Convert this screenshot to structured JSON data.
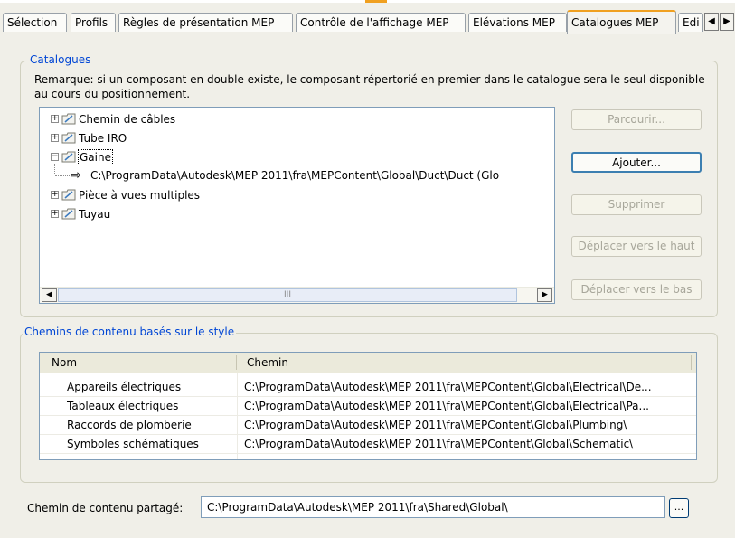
{
  "tabs": [
    {
      "label": "Sélection"
    },
    {
      "label": "Profils"
    },
    {
      "label": "Règles de présentation MEP"
    },
    {
      "label": "Contrôle de l'affichage MEP"
    },
    {
      "label": "Elévations MEP"
    },
    {
      "label": "Catalogues MEP"
    },
    {
      "label": "Edi"
    }
  ],
  "active_tab": "Catalogues MEP",
  "catalogues": {
    "legend": "Catalogues",
    "note": "Remarque: si un composant en double existe, le composant répertorié en premier dans le catalogue sera le seul disponible au cours du positionnement.",
    "tree": [
      {
        "label": "Chemin de câbles",
        "expanded": false
      },
      {
        "label": "Tube IRO",
        "expanded": false
      },
      {
        "label": "Gaine",
        "expanded": true,
        "selected": true
      },
      {
        "label": "C:\\ProgramData\\Autodesk\\MEP 2011\\fra\\MEPContent\\Global\\Duct\\Duct (Glo",
        "child": true
      },
      {
        "label": "Pièce à vues multiples",
        "expanded": false
      },
      {
        "label": "Tuyau",
        "expanded": false
      }
    ],
    "scroll_thumb_grip": "III",
    "buttons": {
      "browse": "Parcourir...",
      "add": "Ajouter...",
      "remove": "Supprimer",
      "move_up": "Déplacer vers le haut",
      "move_down": "Déplacer vers le bas"
    }
  },
  "style_paths": {
    "legend": "Chemins de contenu basés sur le style",
    "columns": [
      "Nom",
      "Chemin"
    ],
    "rows": [
      {
        "name": "Appareils électriques",
        "path": "C:\\ProgramData\\Autodesk\\MEP 2011\\fra\\MEPContent\\Global\\Electrical\\De..."
      },
      {
        "name": "Tableaux électriques",
        "path": "C:\\ProgramData\\Autodesk\\MEP 2011\\fra\\MEPContent\\Global\\Electrical\\Pa..."
      },
      {
        "name": "Raccords de plomberie",
        "path": "C:\\ProgramData\\Autodesk\\MEP 2011\\fra\\MEPContent\\Global\\Plumbing\\"
      },
      {
        "name": "Symboles schématiques",
        "path": "C:\\ProgramData\\Autodesk\\MEP 2011\\fra\\MEPContent\\Global\\Schematic\\"
      }
    ]
  },
  "shared": {
    "label": "Chemin de contenu partagé:",
    "value": "C:\\ProgramData\\Autodesk\\MEP 2011\\fra\\Shared\\Global\\",
    "browse_label": "..."
  },
  "colors": {
    "accent": "#f0a020",
    "legend_text": "#0046d5",
    "panel_bg": "#f0efe8"
  }
}
